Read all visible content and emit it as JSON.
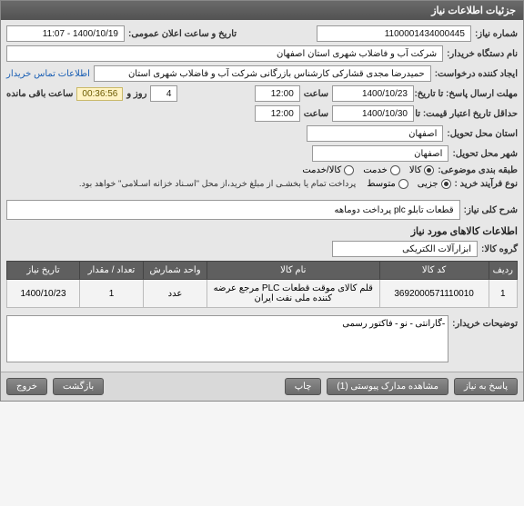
{
  "panel_title": "جزئیات اطلاعات نیاز",
  "fields": {
    "need_number_label": "شماره نیاز:",
    "need_number": "1100001434000445",
    "announce_label": "تاریخ و ساعت اعلان عمومی:",
    "announce_value": "1400/10/19 - 11:07",
    "buyer_org_label": "نام دستگاه خریدار:",
    "buyer_org": "شرکت آب و فاضلاب شهری استان اصفهان",
    "requester_label": "ایجاد کننده درخواست:",
    "requester": "حمیدرضا مجدی قشارکی کارشناس بازرگانی شرکت آب و فاضلاب شهری استان",
    "contact_link": "اطلاعات تماس خریدار",
    "deadline_response_label": "مهلت ارسال پاسخ: تا تاریخ:",
    "deadline_response_date": "1400/10/23",
    "deadline_response_time_label": "ساعت",
    "deadline_response_time": "12:00",
    "days_and": "روز و",
    "days_value": "4",
    "timer": "00:36:56",
    "remaining": "ساعت باقی مانده",
    "price_valid_label": "حداقل تاریخ اعتبار قیمت: تا تاریخ:",
    "price_valid_date": "1400/10/30",
    "price_valid_time": "12:00",
    "exec_province_label": "استان محل تحویل:",
    "exec_province": "اصفهان",
    "exec_city_label": "شهر محل تحویل:",
    "exec_city": "اصفهان",
    "category_label": "طبقه بندی موضوعی:",
    "cat_goods": "کالا",
    "cat_service": "خدمت",
    "cat_both": "کالا/خدمت",
    "purchase_type_label": "نوع فرآیند خرید :",
    "pt_small": "جزیی",
    "pt_medium": "متوسط",
    "purchase_note": "پرداخت تمام یا بخشـی از مبلغ خرید،از محل \"اسـناد خزانه اسـلامی\" خواهد بود.",
    "desc_label": "شرح کلی نیاز:",
    "desc_value": "قطعات تابلو plc  پرداخت دوماهه",
    "items_section": "اطلاعات کالاهای مورد نیاز",
    "group_label": "گروه کالا:",
    "group_value": "ابزارآلات الکتریکی"
  },
  "table": {
    "headers": [
      "ردیف",
      "کد کالا",
      "نام کالا",
      "واحد شمارش",
      "تعداد / مقدار",
      "تاریخ نیاز"
    ],
    "rows": [
      {
        "index": "1",
        "code": "3692000571110010",
        "name": "قلم کالای موقت قطعات PLC مرجع عرضه کننده ملی نفت ایران",
        "unit": "عدد",
        "qty": "1",
        "date": "1400/10/23"
      }
    ]
  },
  "buyer_notes_label": "توضیحات خریدار:",
  "buyer_notes_value": "-گارانتی - نو - فاکتور رسمی",
  "buttons": {
    "reply": "پاسخ به نیاز",
    "attachments": "مشاهده مدارک پیوستی (1)",
    "print": "چاپ",
    "back": "بازگشت",
    "exit": "خروج"
  }
}
